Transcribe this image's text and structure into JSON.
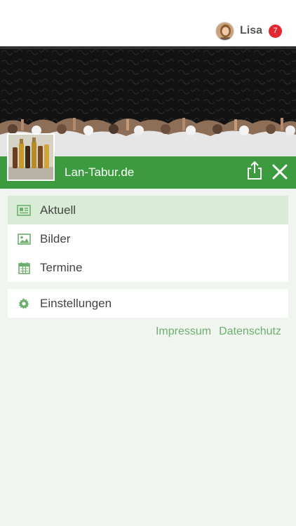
{
  "user": {
    "name": "Lisa",
    "notification_count": "7"
  },
  "site": {
    "title": "Lan-Tabur.de"
  },
  "menu": {
    "items": [
      {
        "label": "Aktuell",
        "icon": "newspaper-icon",
        "active": true
      },
      {
        "label": "Bilder",
        "icon": "image-icon"
      },
      {
        "label": "Termine",
        "icon": "calendar-icon"
      }
    ]
  },
  "settings": {
    "label": "Einstellungen",
    "icon": "gear-icon"
  },
  "footer": {
    "impressum": "Impressum",
    "datenschutz": "Datenschutz"
  },
  "colors": {
    "accent": "#3b9b3e",
    "badge": "#e3262f",
    "active_bg": "#d8ecd6",
    "link": "#6cae6e",
    "icon": "#6cae6e"
  }
}
